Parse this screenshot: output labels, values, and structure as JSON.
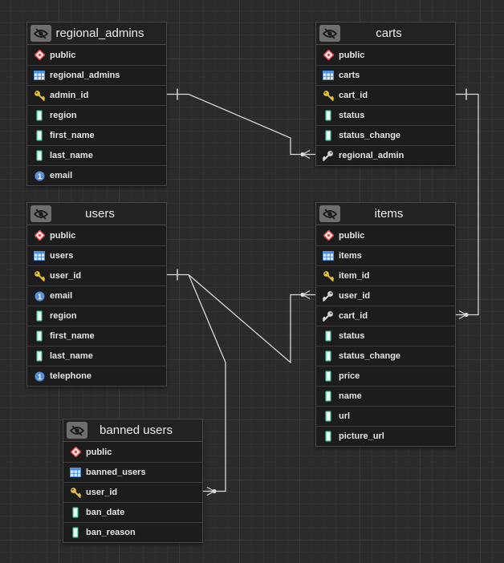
{
  "tables": [
    {
      "name": "regional_admins",
      "schema": "public",
      "table_label": "regional_admins",
      "columns": [
        {
          "name": "admin_id",
          "icon": "primary-key-icon"
        },
        {
          "name": "region",
          "icon": "text-column-icon"
        },
        {
          "name": "first_name",
          "icon": "text-column-icon"
        },
        {
          "name": "last_name",
          "icon": "text-column-icon"
        },
        {
          "name": "email",
          "icon": "number-column-icon"
        }
      ]
    },
    {
      "name": "carts",
      "schema": "public",
      "table_label": "carts",
      "columns": [
        {
          "name": "cart_id",
          "icon": "primary-key-icon"
        },
        {
          "name": "status",
          "icon": "text-column-icon"
        },
        {
          "name": "status_change",
          "icon": "text-column-icon"
        },
        {
          "name": "regional_admin",
          "icon": "foreign-key-icon"
        }
      ]
    },
    {
      "name": "users",
      "schema": "public",
      "table_label": "users",
      "columns": [
        {
          "name": "user_id",
          "icon": "primary-key-icon"
        },
        {
          "name": "email",
          "icon": "number-column-icon"
        },
        {
          "name": "region",
          "icon": "text-column-icon"
        },
        {
          "name": "first_name",
          "icon": "text-column-icon"
        },
        {
          "name": "last_name",
          "icon": "text-column-icon"
        },
        {
          "name": "telephone",
          "icon": "number-column-icon"
        }
      ]
    },
    {
      "name": "items",
      "schema": "public",
      "table_label": "items",
      "columns": [
        {
          "name": "item_id",
          "icon": "primary-key-icon"
        },
        {
          "name": "user_id",
          "icon": "foreign-key-icon"
        },
        {
          "name": "cart_id",
          "icon": "foreign-key-icon"
        },
        {
          "name": "status",
          "icon": "text-column-icon"
        },
        {
          "name": "status_change",
          "icon": "text-column-icon"
        },
        {
          "name": "price",
          "icon": "text-column-icon"
        },
        {
          "name": "name",
          "icon": "text-column-icon"
        },
        {
          "name": "url",
          "icon": "text-column-icon"
        },
        {
          "name": "picture_url",
          "icon": "text-column-icon"
        }
      ]
    },
    {
      "name": "banned users",
      "schema": "public",
      "table_label": "banned_users",
      "columns": [
        {
          "name": "user_id",
          "icon": "primary-key-icon"
        },
        {
          "name": "ban_date",
          "icon": "text-column-icon"
        },
        {
          "name": "ban_reason",
          "icon": "text-column-icon"
        }
      ]
    }
  ],
  "relationships": [
    {
      "from": "regional_admins.admin_id",
      "to": "carts.regional_admin",
      "type": "one-to-many"
    },
    {
      "from": "carts.cart_id",
      "to": "items.cart_id",
      "type": "one-to-many"
    },
    {
      "from": "users.user_id",
      "to": "items.user_id",
      "type": "one-to-many"
    },
    {
      "from": "users.user_id",
      "to": "banned users.user_id",
      "type": "one-to-many"
    }
  ],
  "colors": {
    "background": "#2b2b2b",
    "table_bg": "#1c1c1c",
    "key": "#e8c23a",
    "schema": "#e04a4a",
    "table_icon": "#4a90e2",
    "text_column": "#5fd3b5",
    "number_column": "#5b8fd6",
    "connector": "#d8d8d8"
  }
}
